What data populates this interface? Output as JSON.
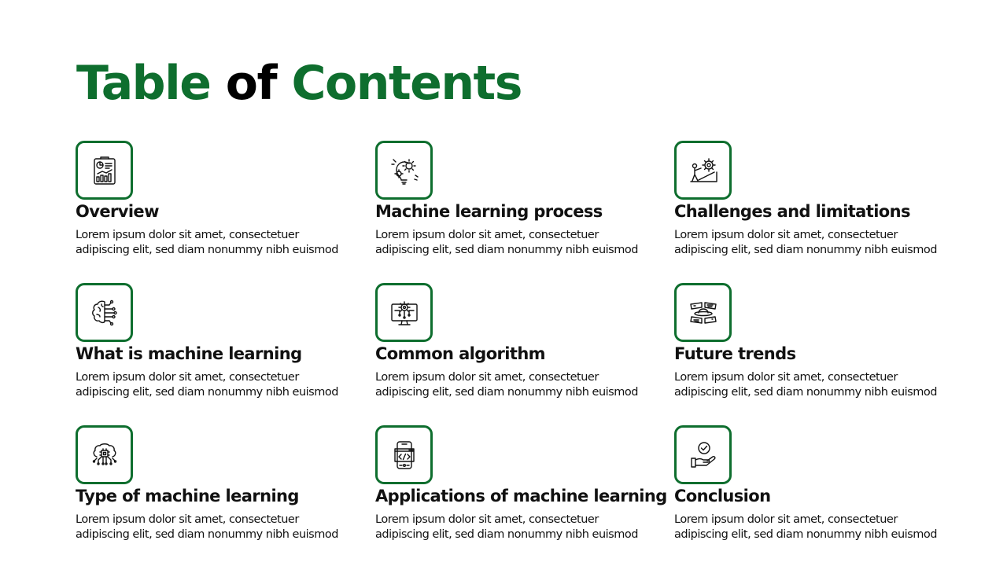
{
  "title": {
    "part1": "Table",
    "part2": "of",
    "part3": "Contents"
  },
  "colors": {
    "accent": "#0e6e2e",
    "text": "#111111"
  },
  "items": [
    {
      "icon": "report-chart-icon",
      "title": "Overview",
      "desc": "Lorem  ipsum dolor  sit amet,  consectetuer\nadipiscing elit, sed diam nonummy  nibh euismod"
    },
    {
      "icon": "lightbulb-gears-icon",
      "title": "Machine learning process",
      "desc": "Lorem  ipsum dolor  sit amet,  consectetuer\nadipiscing elit, sed diam nonummy  nibh euismod"
    },
    {
      "icon": "person-pushing-gear-icon",
      "title": "Challenges and limitations",
      "desc": "Lorem  ipsum dolor  sit amet,  consectetuer\nadipiscing elit, sed diam nonummy  nibh euismod"
    },
    {
      "icon": "brain-circuit-icon",
      "title": "What is machine learning",
      "desc": "Lorem  ipsum dolor  sit amet,  consectetuer\nadipiscing elit, sed diam nonummy  nibh euismod"
    },
    {
      "icon": "monitor-gear-icon",
      "title": "Common algorithm",
      "desc": "Lorem  ipsum dolor  sit amet,  consectetuer\nadipiscing elit, sed diam nonummy  nibh euismod"
    },
    {
      "icon": "planet-panels-icon",
      "title": "Future trends",
      "desc": "Lorem  ipsum dolor  sit amet,  consectetuer\nadipiscing elit, sed diam nonummy  nibh euismod"
    },
    {
      "icon": "brain-chip-icon",
      "title": "Type of machine learning",
      "desc": "Lorem  ipsum dolor  sit amet,  consectetuer\nadipiscing elit, sed diam nonummy  nibh euismod"
    },
    {
      "icon": "mobile-code-icon",
      "title": "Applications of machine learning",
      "desc": "Lorem  ipsum dolor  sit amet,  consectetuer\nadipiscing elit, sed diam nonummy  nibh euismod"
    },
    {
      "icon": "hand-checkmark-icon",
      "title": "Conclusion",
      "desc": "Lorem  ipsum dolor  sit amet,  consectetuer\nadipiscing elit, sed diam nonummy  nibh euismod"
    }
  ]
}
